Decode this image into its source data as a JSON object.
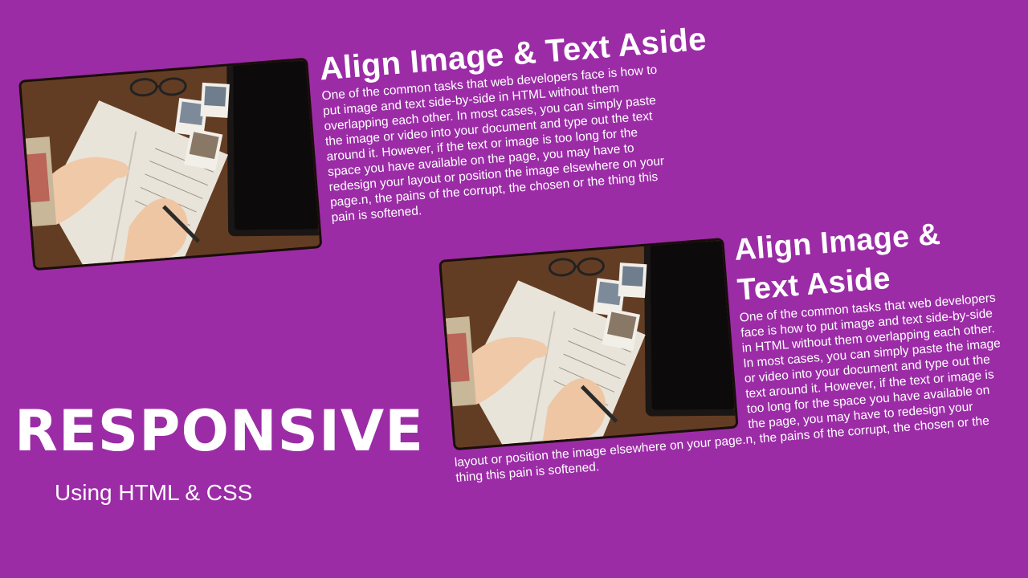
{
  "colors": {
    "background": "#9b2ca6",
    "text": "#ffffff"
  },
  "card_top": {
    "image": "desk-notebook-writing-photo",
    "heading": "Align Image & Text Aside",
    "body": "One of the common tasks that web developers face is how to put image and text side-by-side in HTML without them overlapping each other. In most cases, you can simply paste the image or video into your document and type out the text around it. However, if the text or image is too long for the space you have available on the page, you may have to redesign your layout or position the image elsewhere on your page.n, the pains of the corrupt, the chosen or the thing this pain is softened."
  },
  "card_bottom": {
    "image": "desk-notebook-writing-photo",
    "heading": "Align Image & Text Aside",
    "body": "One of the common tasks that web developers face is how to put image and text side-by-side in HTML without them overlapping each other. In most cases, you can simply paste the image or video into your document and type out the text around it. However, if the text or image is too long for the space you have available on the page, you may have to redesign your layout or position the image elsewhere on your page.n, the pains of the corrupt, the chosen or the thing this pain is softened."
  },
  "title": "RESPONSIVE",
  "subtitle": "Using HTML & CSS"
}
